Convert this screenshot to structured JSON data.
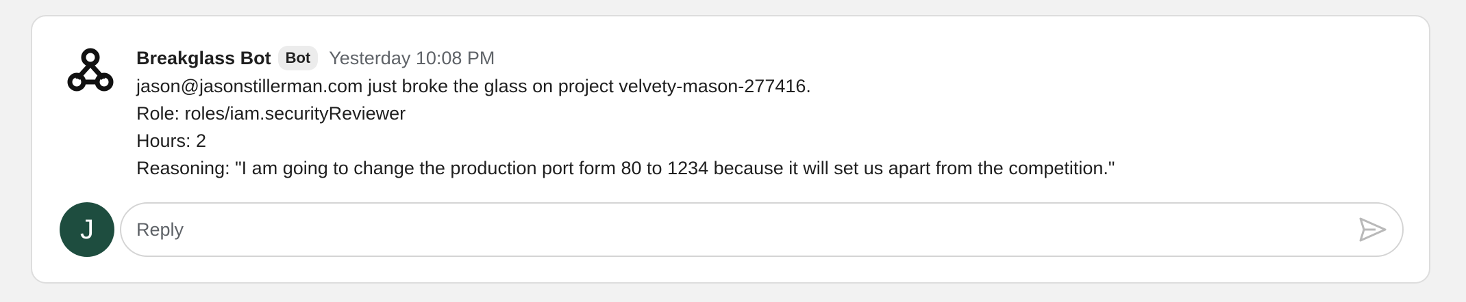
{
  "message": {
    "sender": "Breakglass Bot",
    "badge": "Bot",
    "timestamp": "Yesterday 10:08 PM",
    "avatar_icon": "webhook-icon",
    "lines": [
      "jason@jasonstillerman.com just broke the glass on project velvety-mason-277416.",
      "Role: roles/iam.securityReviewer",
      "Hours: 2",
      "Reasoning: \"I am going to change the production port form 80 to 1234 because it will set us apart from the competition.\""
    ]
  },
  "reply": {
    "avatar_letter": "J",
    "avatar_color": "#1e4d3f",
    "placeholder": "Reply",
    "send_icon": "send-icon"
  },
  "colors": {
    "card_background": "#ffffff",
    "page_background": "#f2f2f2",
    "secondary_text": "#5f6368"
  }
}
